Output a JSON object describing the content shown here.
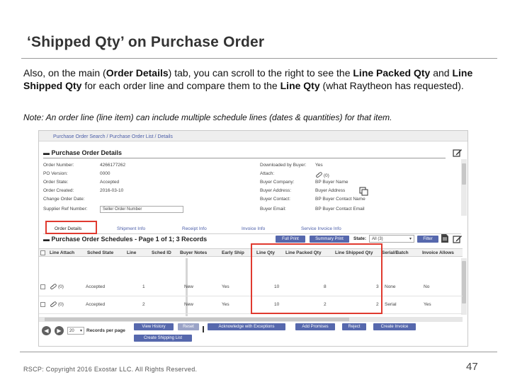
{
  "slide": {
    "title": "‘Shipped Qty’ on Purchase Order",
    "body": {
      "t1": "Also, on the main (",
      "b1": "Order Details",
      "t2": ") tab, you can scroll to the right to see the ",
      "b2": "Line Packed Qty",
      "t3": " and ",
      "b3": "Line Shipped Qty",
      "t4": " for each order line and compare them to the ",
      "b4": "Line Qty",
      "t5": " (what Raytheon has requested)."
    },
    "note": "Note:  An order line (line item) can include multiple schedule lines (dates & quantities) for that item.",
    "footer": "RSCP:  Copyright 2016 Exostar LLC. All Rights Reserved.",
    "page_number": "47"
  },
  "app": {
    "breadcrumb": "Purchase Order Search / Purchase Order List / Details",
    "po_details": {
      "heading": "Purchase Order Details",
      "left_fields": [
        {
          "label": "Order Number:",
          "value": "4266177262"
        },
        {
          "label": "PO Version:",
          "value": "0000"
        },
        {
          "label": "Order State:",
          "value": "Accepted"
        },
        {
          "label": "Order Created:",
          "value": "2016-03-10"
        },
        {
          "label": "Change Order Date:",
          "value": ""
        },
        {
          "label": "Supplier Ref Number:",
          "value": "Seller Order Number"
        }
      ],
      "right_fields": [
        {
          "label": "Downloaded by Buyer:",
          "value": "Yes"
        },
        {
          "label": "Attach:",
          "value": "(0)"
        },
        {
          "label": "Buyer Company:",
          "value": "BP Buyer Name"
        },
        {
          "label": "Buyer Address:",
          "value": "Buyer Address"
        },
        {
          "label": "Buyer Contact:",
          "value": "BP Buyer Contact Name"
        },
        {
          "label": "Buyer Email:",
          "value": "BP Buyer Contact Email"
        }
      ]
    },
    "tabs": [
      "Order Details",
      "Shipment Info",
      "Receipt Info",
      "Invoice Info",
      "Service Invoice Info"
    ],
    "schedules": {
      "heading": "Purchase Order Schedules - Page 1 of 1; 3 Records",
      "buttons": {
        "full_print": "Full Print",
        "summary_print": "Summary Print",
        "filter": "Filter"
      },
      "state_label": "State:",
      "state_value": "All (3)",
      "columns": [
        "Line Attach",
        "Sched State",
        "Line",
        "Sched ID",
        "Buyer Notes",
        "Early Ship",
        "Line Qty",
        "Line Packed Qty",
        "Line Shipped Qty",
        "Serial/Batch",
        "Invoice Allows"
      ],
      "rows": [
        {
          "attach": "(0)",
          "state": "Accepted",
          "line": "1",
          "buyer_notes": "New",
          "early_ship": "Yes",
          "line_qty": "10",
          "packed": "8",
          "shipped": "3",
          "serial": "None",
          "invoice": "No"
        },
        {
          "attach": "(0)",
          "state": "Accepted",
          "line": "2",
          "buyer_notes": "New",
          "early_ship": "Yes",
          "line_qty": "10",
          "packed": "2",
          "shipped": "2",
          "serial": "Serial",
          "invoice": "Yes"
        }
      ]
    },
    "pagination": {
      "page_size": "20",
      "rpp_label": "Records per page"
    },
    "actions": [
      "View History",
      "Reset",
      "Acknowledge with Exceptions",
      "Add Promises",
      "Reject",
      "Create Invoice",
      "Create Shipping List"
    ],
    "colors": {
      "accent": "#5668ad",
      "link": "#4b5ea8",
      "highlight": "#e03a2f"
    }
  }
}
